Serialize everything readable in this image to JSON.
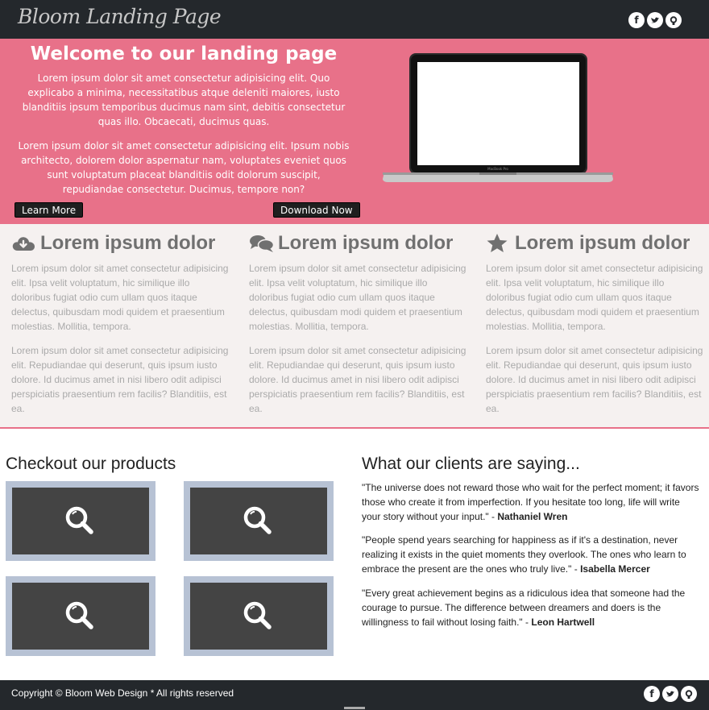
{
  "header": {
    "logo": "Bloom Landing Page",
    "social": [
      {
        "icon": "facebook-icon",
        "glyph": "f"
      },
      {
        "icon": "twitter-icon",
        "glyph": "t"
      },
      {
        "icon": "github-icon",
        "glyph": "g"
      }
    ]
  },
  "hero": {
    "title": "Welcome to our landing page",
    "paragraph1": "Lorem ipsum dolor sit amet consectetur adipisicing elit. Quo explicabo a minima, necessitatibus atque deleniti maiores, iusto blanditiis ipsum temporibus ducimus nam sint, debitis consectetur quas illo. Obcaecati, ducimus quas.",
    "paragraph2": "Lorem ipsum dolor sit amet consectetur adipisicing elit. Ipsum nobis architecto, dolorem dolor aspernatur nam, voluptates eveniet quos sunt voluptatum placeat blanditiis odit dolorum suscipit, repudiandae consectetur. Ducimus, tempore non?",
    "learn_more": "Learn More",
    "download_now": "Download Now",
    "laptop_label": "MacBook Pro"
  },
  "features": [
    {
      "icon": "cloud-download-icon",
      "title": "Lorem ipsum dolor",
      "p1": "Lorem ipsum dolor sit amet consectetur adipisicing elit. Ipsa velit voluptatum, hic similique illo doloribus fugiat odio cum ullam quos itaque delectus, quibusdam modi quidem et praesentium molestias. Mollitia, tempora.",
      "p2": "Lorem ipsum dolor sit amet consectetur adipisicing elit. Repudiandae qui deserunt, quis ipsum iusto dolore. Id ducimus amet in nisi libero odit adipisci perspiciatis praesentium rem facilis? Blanditiis, est ea."
    },
    {
      "icon": "comments-icon",
      "title": "Lorem ipsum dolor",
      "p1": "Lorem ipsum dolor sit amet consectetur adipisicing elit. Ipsa velit voluptatum, hic similique illo doloribus fugiat odio cum ullam quos itaque delectus, quibusdam modi quidem et praesentium molestias. Mollitia, tempora.",
      "p2": "Lorem ipsum dolor sit amet consectetur adipisicing elit. Repudiandae qui deserunt, quis ipsum iusto dolore. Id ducimus amet in nisi libero odit adipisci perspiciatis praesentium rem facilis? Blanditiis, est ea."
    },
    {
      "icon": "star-icon",
      "title": "Lorem ipsum dolor",
      "p1": "Lorem ipsum dolor sit amet consectetur adipisicing elit. Ipsa velit voluptatum, hic similique illo doloribus fugiat odio cum ullam quos itaque delectus, quibusdam modi quidem et praesentium molestias. Mollitia, tempora.",
      "p2": "Lorem ipsum dolor sit amet consectetur adipisicing elit. Repudiandae qui deserunt, quis ipsum iusto dolore. Id ducimus amet in nisi libero odit adipisci perspiciatis praesentium rem facilis? Blanditiis, est ea."
    }
  ],
  "products": {
    "title": "Checkout our products",
    "tile_icon": "magnifier-icon"
  },
  "clients": {
    "title": "What our clients are saying...",
    "quotes": [
      {
        "text": "\"The universe does not reward those who wait for the perfect moment; it favors those who create it from imperfection. If you hesitate too long, life will write your story without your input.\" - ",
        "author": "Nathaniel Wren"
      },
      {
        "text": "\"People spend years searching for happiness as if it's a destination, never realizing it exists in the quiet moments they overlook. The ones who learn to embrace the present are the ones who truly live.\" - ",
        "author": "Isabella Mercer"
      },
      {
        "text": "\"Every great achievement begins as a ridiculous idea that someone had the courage to pursue. The difference between dreamers and doers is the willingness to fail without losing faith.\" - ",
        "author": "Leon Hartwell"
      }
    ]
  },
  "footer": {
    "copyright": "Copyright © Bloom Web Design * All rights reserved"
  },
  "colors": {
    "header_bg": "#24282c",
    "hero_bg": "#e87189",
    "features_bg": "#f5f1f0",
    "tile_frame": "#b7c2d4",
    "tile_inner": "#444444"
  }
}
